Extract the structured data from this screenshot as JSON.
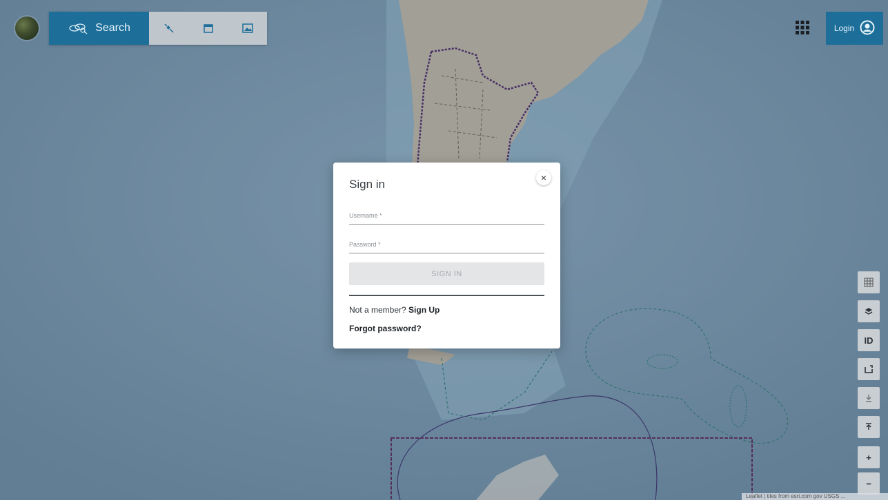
{
  "toolbar": {
    "search_label": "Search",
    "icons": [
      "search-layers-icon",
      "satellite-icon",
      "calendar-icon",
      "image-icon"
    ]
  },
  "header": {
    "apps_icon": "apps-grid-icon",
    "login_label": "Login",
    "login_icon": "account-circle-icon"
  },
  "map_controls": [
    "grid-icon",
    "layers-icon",
    "ID",
    "draw-area-icon",
    "download-icon",
    "upload-icon",
    "+",
    "−"
  ],
  "attribution": "Leaflet | tiles from esri.com gov USGS ...",
  "modal": {
    "title": "Sign in",
    "close_icon": "×",
    "username_placeholder": "Username *",
    "password_placeholder": "Password *",
    "signin_label": "SIGN IN",
    "not_member_text": "Not a member?",
    "signup_label": "Sign Up",
    "forgot_label": "Forgot password?"
  },
  "colors": {
    "accent": "#1d6f9a",
    "ocean": "#6f8fa8",
    "land": "#b7b0a4"
  }
}
